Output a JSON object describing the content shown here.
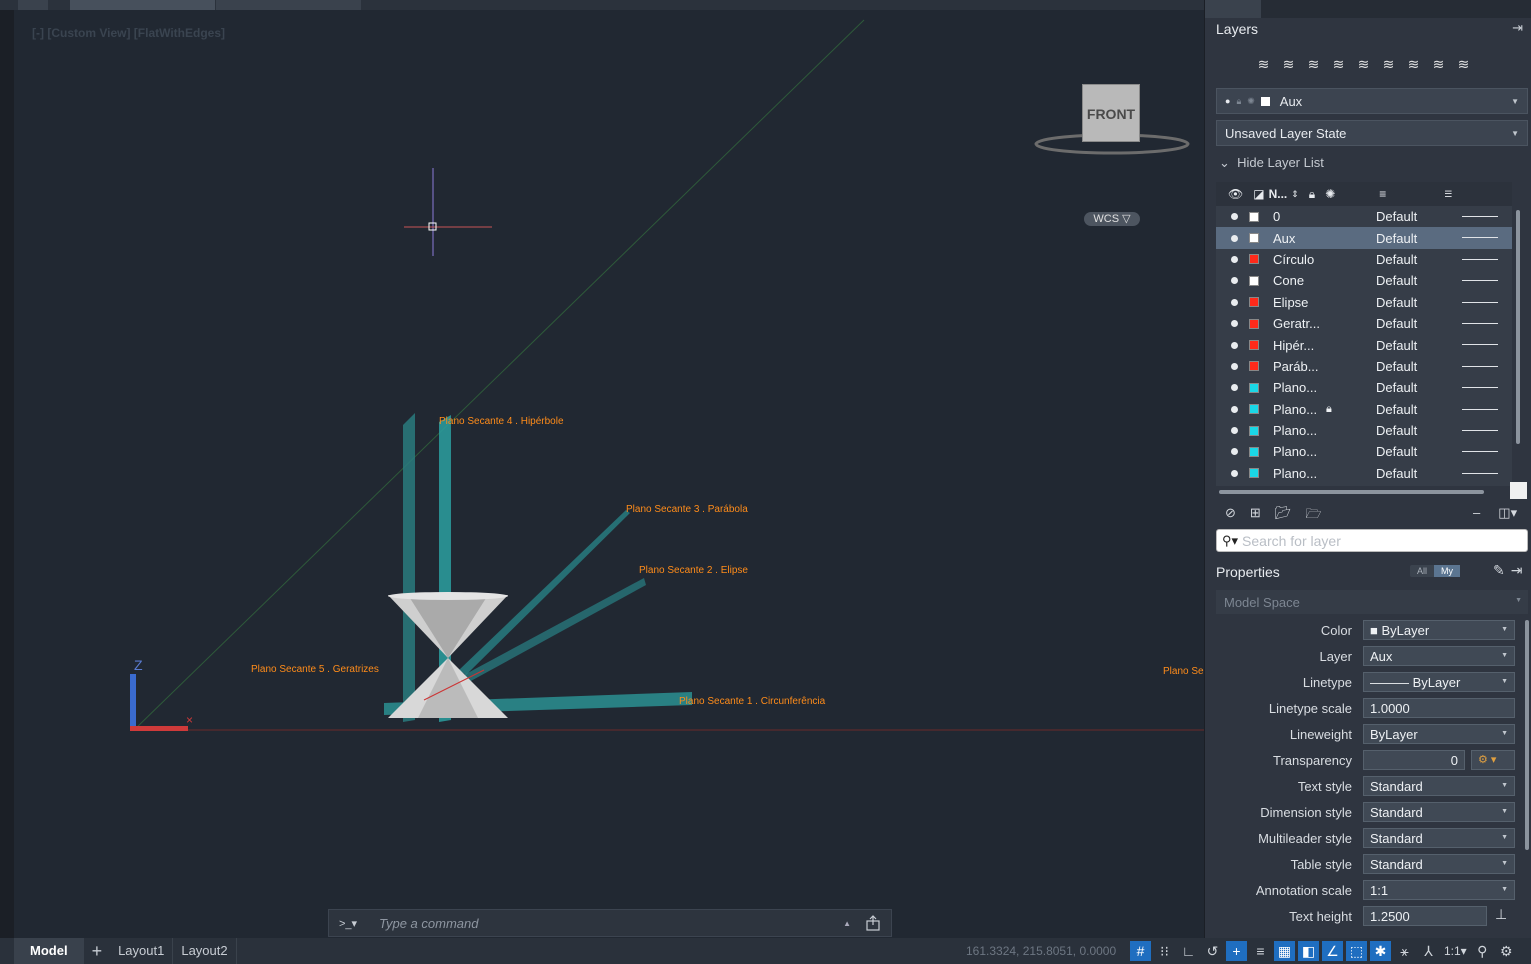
{
  "viewport": {
    "view_label": "[-] [Custom View] [FlatWithEdges]",
    "viewcube_face": "FRONT",
    "wcs_label": "WCS ▽",
    "labels": {
      "plano4": "Plano Secante 4 . Hipérbole",
      "plano3": "Plano Secante 3 . Parábola",
      "plano2": "Plano Secante 2 . Elipse",
      "plano5": "Plano Secante 5 . Geratrizes",
      "plano1": "Plano Secante 1 . Circunferência",
      "plano_cut": "Plano Se"
    }
  },
  "command_line": {
    "prompt": ">_▾",
    "placeholder": "Type a command"
  },
  "status_bar": {
    "tabs": [
      "Model",
      "Layout1",
      "Layout2"
    ],
    "add": "+",
    "coordinates": "161.3324, 215.8051, 0.0000",
    "scale": "1:1▾"
  },
  "layers_panel": {
    "title": "Layers",
    "current_layer": "Aux",
    "layer_state": "Unsaved Layer State",
    "hide_list": "Hide Layer List",
    "column_name": "N...",
    "search_placeholder": "Search for layer",
    "layers": [
      {
        "name": "0",
        "color": "#ffffff",
        "linetype": "Default",
        "locked": false,
        "selected": false
      },
      {
        "name": "Aux",
        "color": "#ffffff",
        "linetype": "Default",
        "locked": false,
        "selected": true
      },
      {
        "name": "Círculo",
        "color": "#ff2a1a",
        "linetype": "Default",
        "locked": false,
        "selected": false
      },
      {
        "name": "Cone",
        "color": "#ffffff",
        "linetype": "Default",
        "locked": false,
        "selected": false
      },
      {
        "name": "Elipse",
        "color": "#ff2a1a",
        "linetype": "Default",
        "locked": false,
        "selected": false
      },
      {
        "name": "Geratr...",
        "color": "#ff2a1a",
        "linetype": "Default",
        "locked": false,
        "selected": false
      },
      {
        "name": "Hipér...",
        "color": "#ff2a1a",
        "linetype": "Default",
        "locked": false,
        "selected": false
      },
      {
        "name": "Paráb...",
        "color": "#ff2a1a",
        "linetype": "Default",
        "locked": false,
        "selected": false
      },
      {
        "name": "Plano...",
        "color": "#1ad7e6",
        "linetype": "Default",
        "locked": false,
        "selected": false
      },
      {
        "name": "Plano...",
        "color": "#1ad7e6",
        "linetype": "Default",
        "locked": true,
        "selected": false
      },
      {
        "name": "Plano...",
        "color": "#1ad7e6",
        "linetype": "Default",
        "locked": false,
        "selected": false
      },
      {
        "name": "Plano...",
        "color": "#1ad7e6",
        "linetype": "Default",
        "locked": false,
        "selected": false
      },
      {
        "name": "Plano...",
        "color": "#1ad7e6",
        "linetype": "Default",
        "locked": false,
        "selected": false
      }
    ]
  },
  "properties_panel": {
    "title": "Properties",
    "toggle_all": "All",
    "toggle_my": "My",
    "context": "Model Space",
    "rows": [
      {
        "label": "Color",
        "value": "■  ByLayer",
        "dropdown": true
      },
      {
        "label": "Layer",
        "value": "Aux",
        "dropdown": true
      },
      {
        "label": "Linetype",
        "value": "——— ByLayer",
        "dropdown": true
      },
      {
        "label": "Linetype scale",
        "value": "1.0000",
        "dropdown": false
      },
      {
        "label": "Lineweight",
        "value": "ByLayer",
        "dropdown": true
      },
      {
        "label": "Transparency",
        "value": "0",
        "dropdown": true
      },
      {
        "label": "Text style",
        "value": "Standard",
        "dropdown": true
      },
      {
        "label": "Dimension style",
        "value": "Standard",
        "dropdown": true
      },
      {
        "label": "Multileader style",
        "value": "Standard",
        "dropdown": true
      },
      {
        "label": "Table style",
        "value": "Standard",
        "dropdown": true
      },
      {
        "label": "Annotation scale",
        "value": "1:1",
        "dropdown": true
      },
      {
        "label": "Text height",
        "value": "1.2500",
        "dropdown": false
      }
    ]
  },
  "colors": {
    "accent": "#1f6ec0",
    "cad_label": "#ff8c1a",
    "plane": "#2a9fa0"
  }
}
